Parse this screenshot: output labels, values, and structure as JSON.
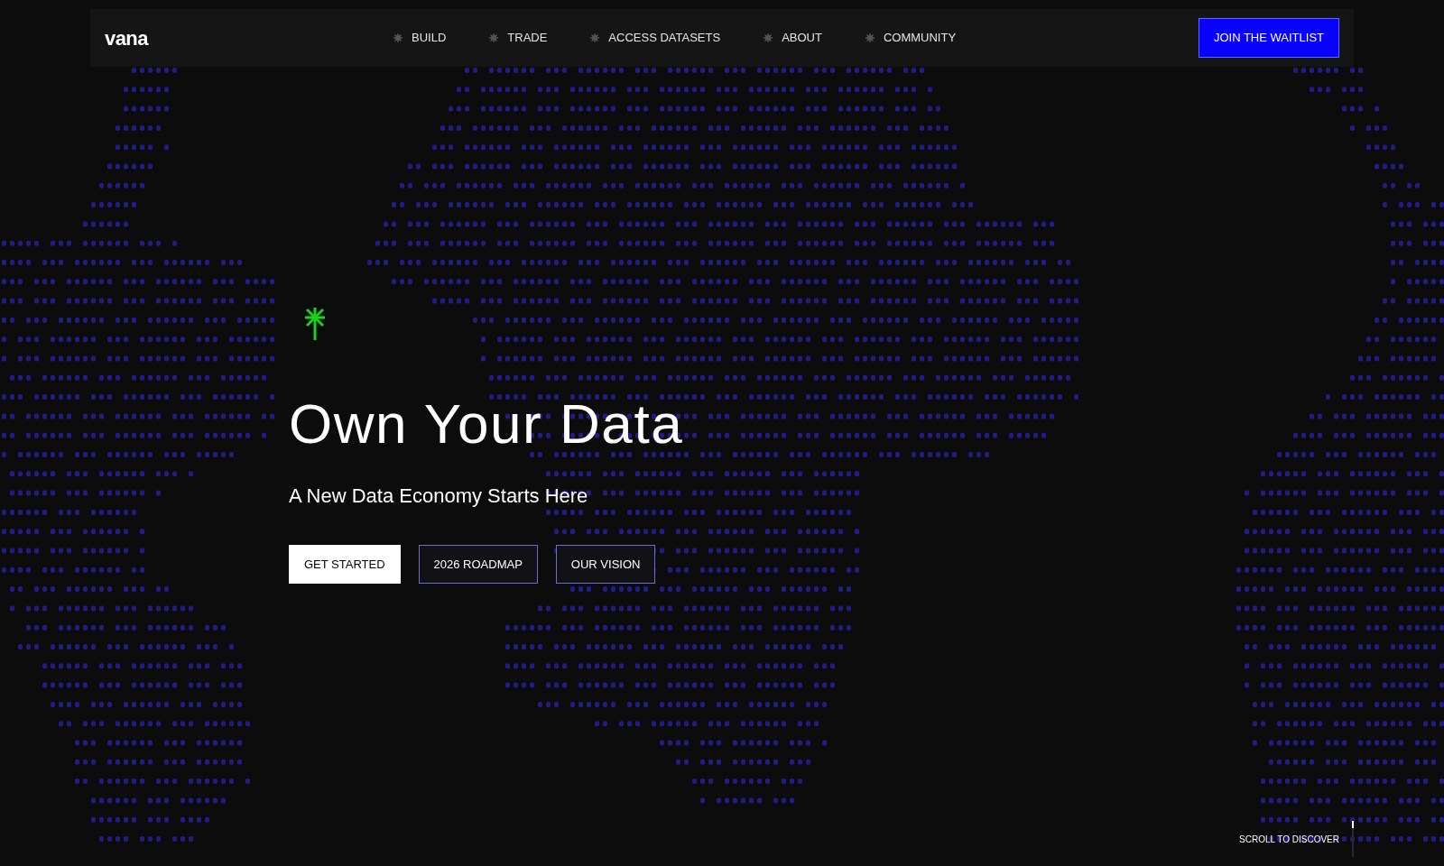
{
  "logo": "vana",
  "nav": [
    {
      "label": "BUILD"
    },
    {
      "label": "TRADE"
    },
    {
      "label": "ACCESS DATASETS"
    },
    {
      "label": "ABOUT"
    },
    {
      "label": "COMMUNITY"
    }
  ],
  "cta": "JOIN THE WAITLIST",
  "hero": {
    "title": "Own Your Data",
    "subtitle": "A New Data Economy Starts Here",
    "buttons": [
      {
        "label": "GET STARTED",
        "kind": "primary"
      },
      {
        "label": "2026 ROADMAP",
        "kind": "outline"
      },
      {
        "label": "OUR VISION",
        "kind": "outline"
      }
    ]
  },
  "scroll_hint": "SCROLL TO DISCOVER"
}
